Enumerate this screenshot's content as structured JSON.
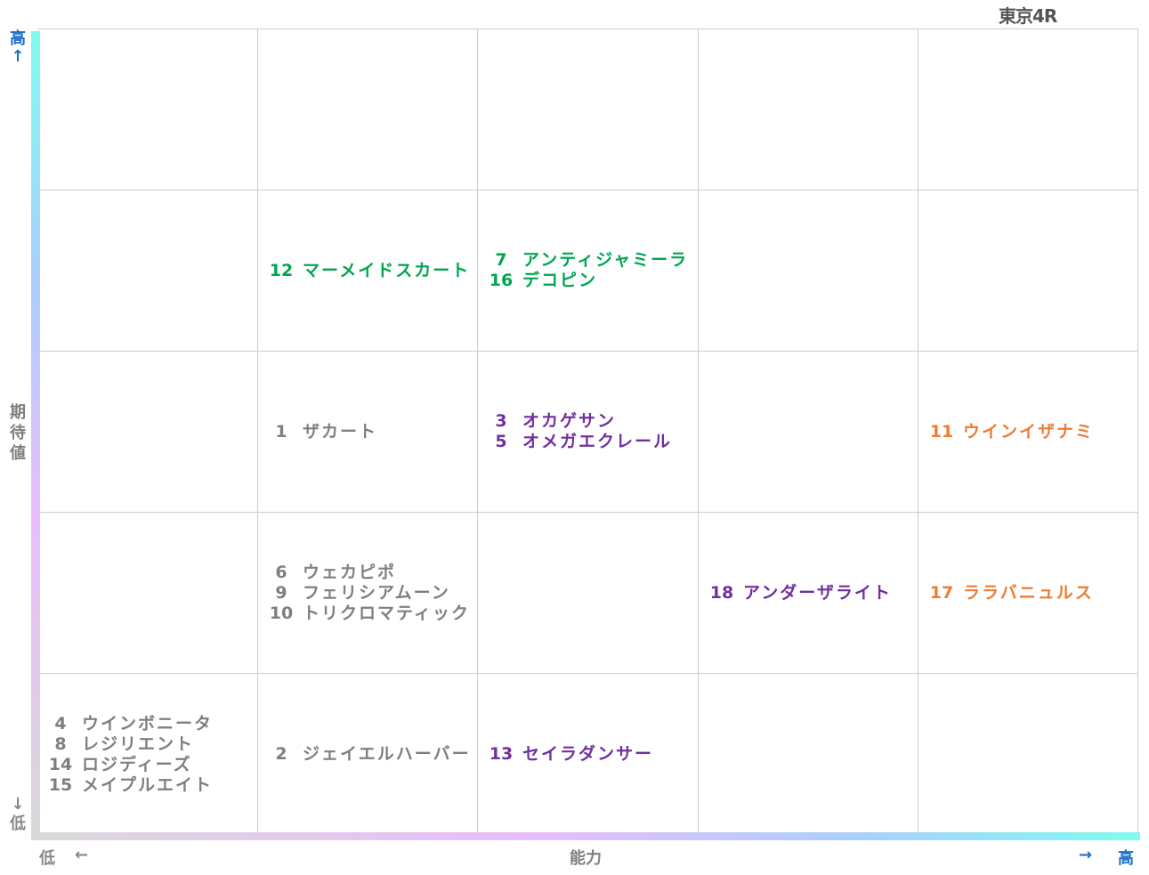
{
  "race_title": "東京4R",
  "y_axis": {
    "high": "高",
    "high_arrow": "↑",
    "title_chars": [
      "期",
      "待",
      "値"
    ],
    "low_arrow": "↓",
    "low": "低"
  },
  "x_axis": {
    "low": "低",
    "low_arrow": "←",
    "title": "能力",
    "high_arrow": "→",
    "high": "高"
  },
  "colors": {
    "gray": "#7f7f7f",
    "green": "#00a650",
    "purple": "#7030a0",
    "orange": "#ed7d31"
  },
  "chart_data": {
    "type": "table",
    "title": "東京4R",
    "xlabel": "能力",
    "ylabel": "期待値",
    "columns": 5,
    "rows": 5,
    "cells": [
      {
        "row": 2,
        "col": 2,
        "color": "green",
        "entries": [
          {
            "num": "12",
            "name": "マーメイドスカート"
          }
        ]
      },
      {
        "row": 2,
        "col": 3,
        "color": "green",
        "entries": [
          {
            "num": "7",
            "name": "アンティジャミーラ"
          },
          {
            "num": "16",
            "name": "デコピン"
          }
        ]
      },
      {
        "row": 3,
        "col": 2,
        "color": "gray",
        "entries": [
          {
            "num": "1",
            "name": "ザカート"
          }
        ]
      },
      {
        "row": 3,
        "col": 3,
        "color": "purple",
        "entries": [
          {
            "num": "3",
            "name": "オカゲサン"
          },
          {
            "num": "5",
            "name": "オメガエクレール"
          }
        ]
      },
      {
        "row": 3,
        "col": 5,
        "color": "orange",
        "entries": [
          {
            "num": "11",
            "name": "ウインイザナミ"
          }
        ]
      },
      {
        "row": 4,
        "col": 2,
        "color": "gray",
        "entries": [
          {
            "num": "6",
            "name": "ウェカピポ"
          },
          {
            "num": "9",
            "name": "フェリシアムーン"
          },
          {
            "num": "10",
            "name": "トリクロマティック"
          }
        ]
      },
      {
        "row": 4,
        "col": 4,
        "color": "purple",
        "entries": [
          {
            "num": "18",
            "name": "アンダーザライト"
          }
        ]
      },
      {
        "row": 4,
        "col": 5,
        "color": "orange",
        "entries": [
          {
            "num": "17",
            "name": "ララバニュルス"
          }
        ]
      },
      {
        "row": 5,
        "col": 1,
        "color": "gray",
        "entries": [
          {
            "num": "4",
            "name": "ウインボニータ"
          },
          {
            "num": "8",
            "name": "レジリエント"
          },
          {
            "num": "14",
            "name": "ロジディーズ"
          },
          {
            "num": "15",
            "name": "メイプルエイト"
          }
        ]
      },
      {
        "row": 5,
        "col": 2,
        "color": "gray",
        "entries": [
          {
            "num": "2",
            "name": "ジェイエルハーバー"
          }
        ]
      },
      {
        "row": 5,
        "col": 3,
        "color": "purple",
        "entries": [
          {
            "num": "13",
            "name": "セイラダンサー"
          }
        ]
      }
    ]
  }
}
